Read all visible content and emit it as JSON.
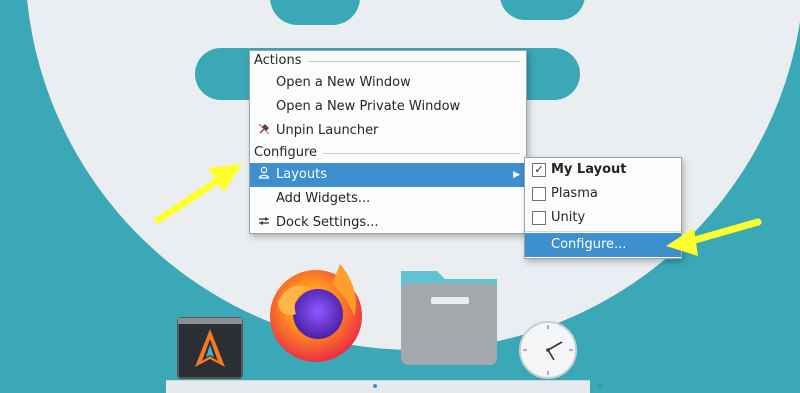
{
  "context_menu": {
    "actions_header": "Actions",
    "open_new_window": "Open a New Window",
    "open_new_private_window": "Open a New Private Window",
    "unpin_launcher": "Unpin Launcher",
    "configure_header": "Configure",
    "layouts": "Layouts",
    "add_widgets": "Add Widgets...",
    "dock_settings": "Dock Settings..."
  },
  "layouts_submenu": {
    "items": [
      {
        "label": "My Layout",
        "checked": true
      },
      {
        "label": "Plasma",
        "checked": false
      },
      {
        "label": "Unity",
        "checked": false
      }
    ],
    "configure": "Configure..."
  },
  "dock": {
    "apps": [
      "launcher-app-icon",
      "firefox-icon",
      "file-manager-icon",
      "clock-icon"
    ]
  },
  "colors": {
    "highlight": "#3d8fce",
    "annotation_arrow": "#ffff2e",
    "wallpaper": "#3aa8b6"
  }
}
